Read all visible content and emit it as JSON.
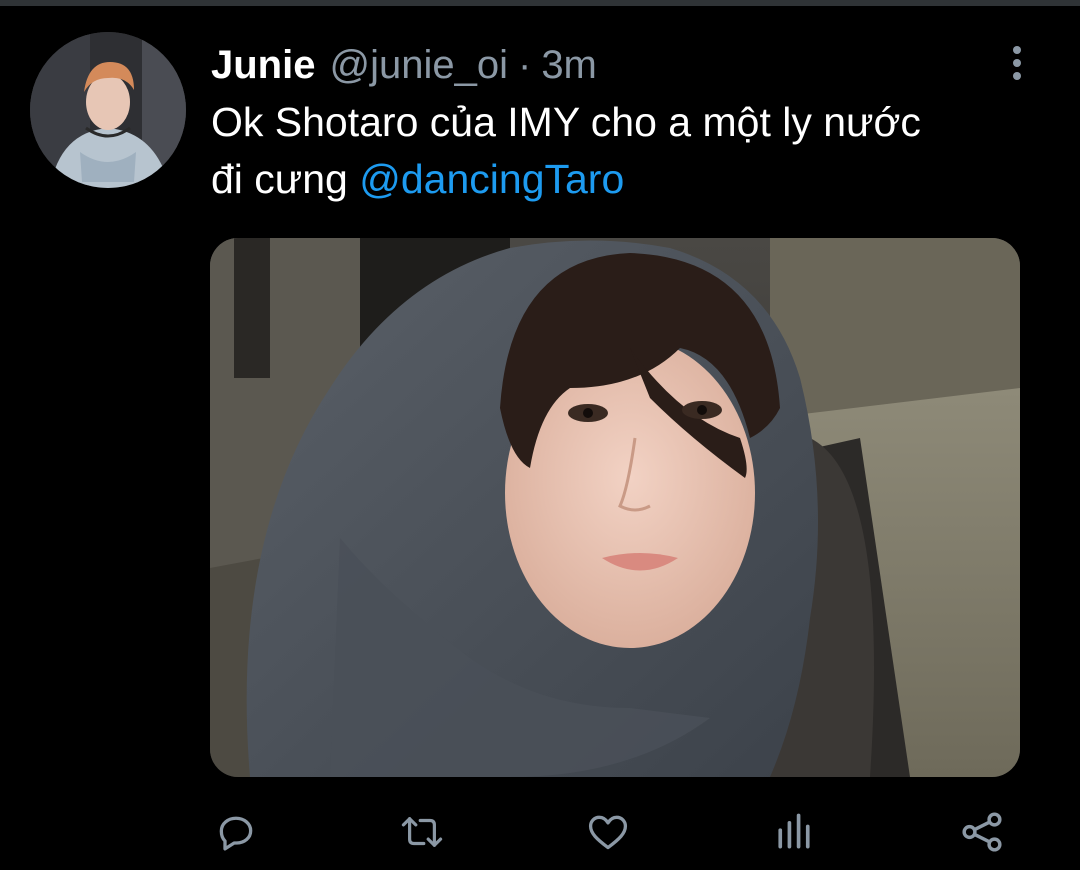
{
  "tweet": {
    "display_name": "Junie",
    "handle": "@junie_oi",
    "separator": "·",
    "time": "3m",
    "text_line1": "Ok Shotaro của IMY cho a một ly nước",
    "text_line2_prefix": "đi cưng ",
    "mention": "@dancingTaro"
  },
  "icons": {
    "more": "more-vertical-icon",
    "reply": "reply-icon",
    "retweet": "retweet-icon",
    "like": "heart-icon",
    "analytics": "analytics-icon",
    "share": "share-icon"
  },
  "colors": {
    "background": "#000000",
    "text": "#ffffff",
    "secondary": "#8b98a5",
    "link": "#1d9bf0"
  }
}
